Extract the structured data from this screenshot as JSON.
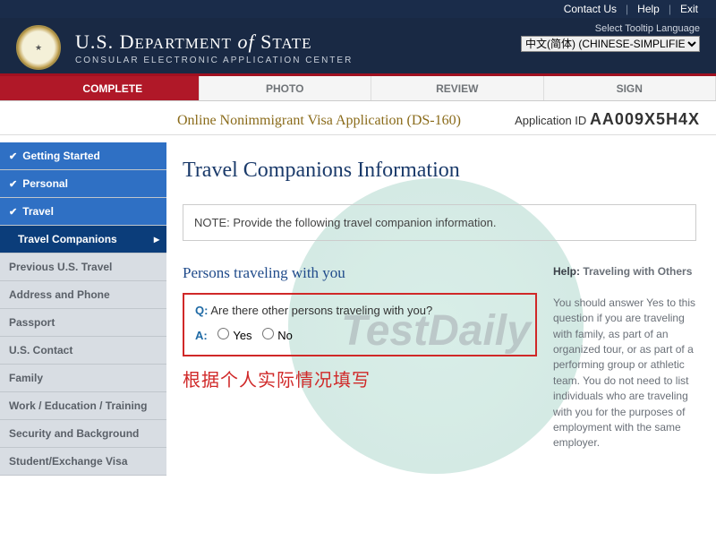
{
  "topbar": {
    "contact": "Contact Us",
    "help": "Help",
    "exit": "Exit"
  },
  "header": {
    "dept1": "U.S. D",
    "dept2": "EPARTMENT",
    "of": "of",
    "dept3": "S",
    "dept4": "TATE",
    "sub": "CONSULAR ELECTRONIC APPLICATION CENTER",
    "langLabel": "Select Tooltip Language",
    "langValue": "中文(简体) (CHINESE-SIMPLIFIED)"
  },
  "tabs": {
    "complete": "COMPLETE",
    "photo": "PHOTO",
    "review": "REVIEW",
    "sign": "SIGN"
  },
  "appline": {
    "title": "Online Nonimmigrant Visa Application (DS-160)",
    "idLabel": "Application ID",
    "idValue": "AA009X5H4X"
  },
  "sidebar": [
    {
      "label": "Getting Started",
      "state": "done"
    },
    {
      "label": "Personal",
      "state": "done"
    },
    {
      "label": "Travel",
      "state": "done"
    },
    {
      "label": "Travel Companions",
      "state": "current"
    },
    {
      "label": "Previous U.S. Travel",
      "state": "todo"
    },
    {
      "label": "Address and Phone",
      "state": "todo"
    },
    {
      "label": "Passport",
      "state": "todo"
    },
    {
      "label": "U.S. Contact",
      "state": "todo"
    },
    {
      "label": "Family",
      "state": "todo"
    },
    {
      "label": "Work / Education / Training",
      "state": "todo"
    },
    {
      "label": "Security and Background",
      "state": "todo"
    },
    {
      "label": "Student/Exchange Visa",
      "state": "todo"
    }
  ],
  "main": {
    "pageTitle": "Travel Companions Information",
    "note": "NOTE: Provide the following travel companion information.",
    "sectionHeader": "Persons traveling with you",
    "qLabel": "Q:",
    "question": "Are there other persons traveling with you?",
    "aLabel": "A:",
    "optYes": "Yes",
    "optNo": "No",
    "annotation": "根据个人实际情况填写",
    "helpTitle1": "Help:",
    "helpTitle2": "Traveling with Others",
    "helpBody": "You should answer Yes to this question if you are traveling with family, as part of an organized tour, or as part of a performing group or athletic team. You do not need to list individuals who are traveling with you for the purposes of employment with the same employer."
  },
  "watermark": "TestDaily"
}
